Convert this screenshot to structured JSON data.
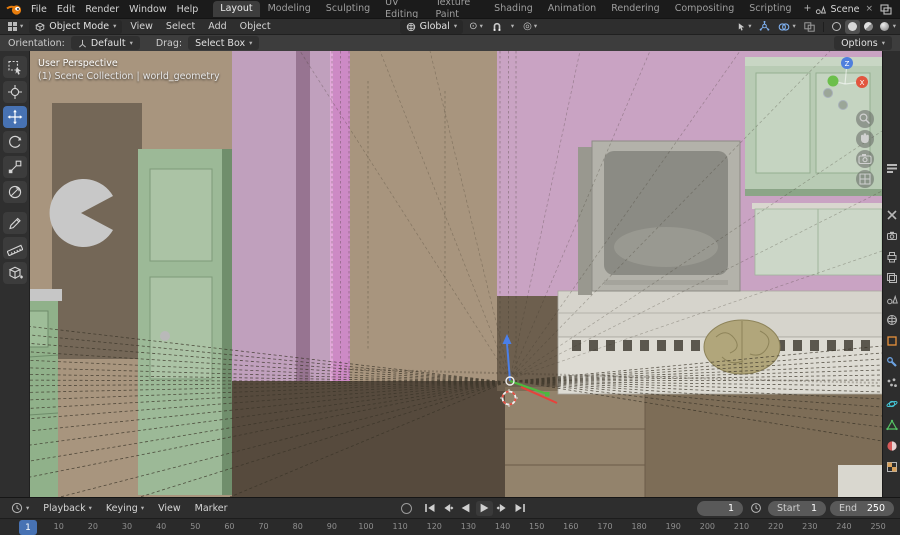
{
  "ui": {
    "caret": "▾",
    "close": "×",
    "proportional_icon": "◎",
    "pivot_icon": "⊙"
  },
  "colors": {
    "accent_blue": "#4772b3",
    "axis_x": "#e2553f",
    "axis_y": "#6cbf4b",
    "axis_z": "#4f7fdd",
    "wall_tan": "#a8957e",
    "wall_pink": "#c0a0bd",
    "cabinet_green": "#9cb997"
  },
  "topbar": {
    "menus": [
      "File",
      "Edit",
      "Render",
      "Window",
      "Help"
    ],
    "workspaces": [
      "Layout",
      "Modeling",
      "Sculpting",
      "UV Editing",
      "Texture Paint",
      "Shading",
      "Animation",
      "Rendering",
      "Compositing",
      "Scripting"
    ],
    "active_workspace": "Layout",
    "add_tab": "+",
    "scene_name": "Scene"
  },
  "viewport_header": {
    "mode": "Object Mode",
    "menus": [
      "View",
      "Select",
      "Add",
      "Object"
    ],
    "transform_orientation": "Global"
  },
  "tool_settings": {
    "orientation_label": "Orientation:",
    "orientation_value": "Default",
    "drag_label": "Drag:",
    "drag_value": "Select Box",
    "options": "Options"
  },
  "viewport": {
    "view_label": "User Perspective",
    "collection_label": "(1) Scene Collection | world_geometry",
    "nav_axis_x": "X",
    "nav_axis_z": "Z"
  },
  "timeline": {
    "menus": [
      "Playback",
      "Keying",
      "View",
      "Marker"
    ],
    "current_frame": "1",
    "start_label": "Start",
    "start_value": "1",
    "end_label": "End",
    "end_value": "250",
    "playhead_frame": "1",
    "ruler_ticks": [
      "1",
      "10",
      "20",
      "30",
      "40",
      "50",
      "60",
      "70",
      "80",
      "90",
      "100",
      "110",
      "120",
      "130",
      "140",
      "150",
      "160",
      "170",
      "180",
      "190",
      "200",
      "210",
      "220",
      "230",
      "240",
      "250"
    ]
  }
}
